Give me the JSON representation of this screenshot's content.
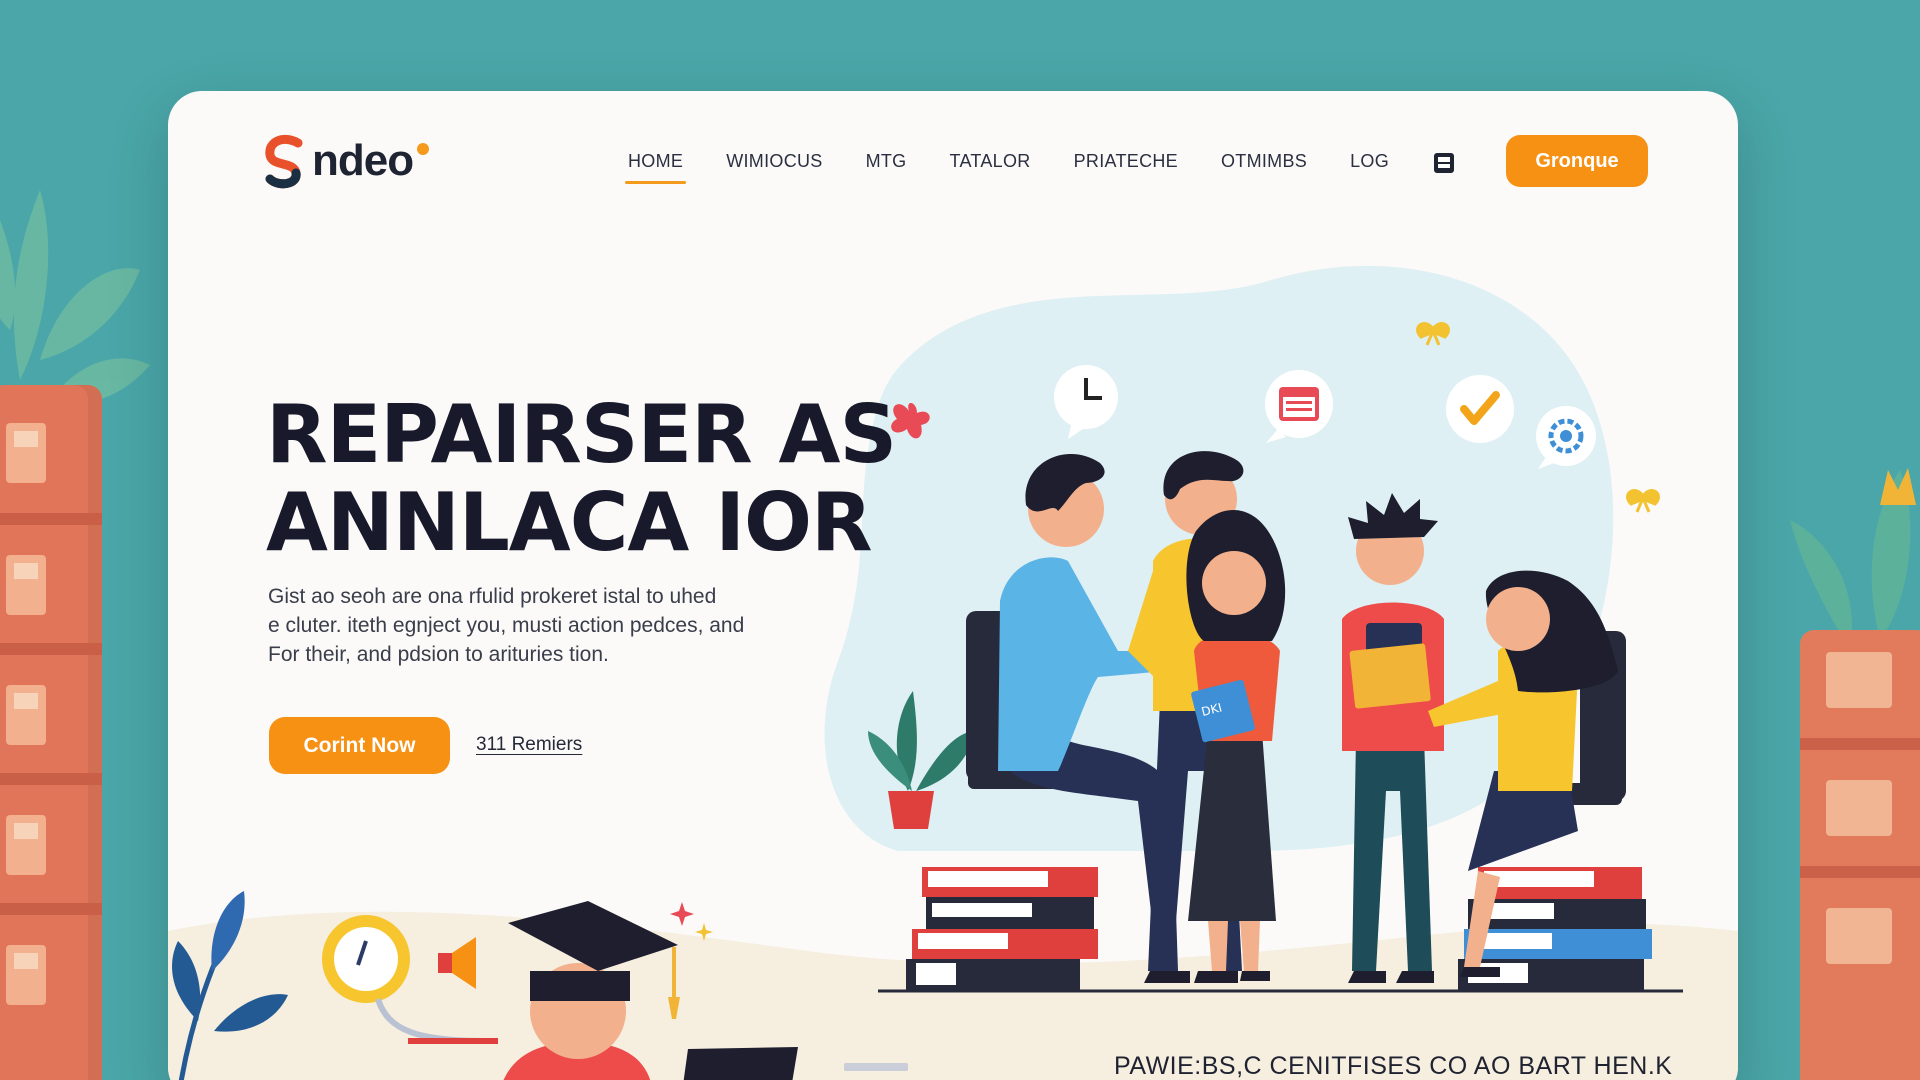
{
  "brand": {
    "name": "ndeo"
  },
  "nav": {
    "items": [
      {
        "label": "HOME",
        "active": true
      },
      {
        "label": "WIMIOCUS",
        "active": false
      },
      {
        "label": "MTG",
        "active": false
      },
      {
        "label": "TATALOR",
        "active": false
      },
      {
        "label": "PRIATECHE",
        "active": false
      },
      {
        "label": "OTMIMBS",
        "active": false
      },
      {
        "label": "LOG",
        "active": false
      }
    ],
    "icon": "bookmark-icon",
    "cta_label": "Gronque"
  },
  "hero": {
    "title_lines": [
      "REPAIRSER AS",
      "ANNLACA IOR"
    ],
    "description_lines": [
      "Gist ao seoh are ona rfulid prokeret istal to uhed",
      "e cluter. iteth egnject you, musti action pedces, and",
      "For their, and pdsion to arituries tion."
    ],
    "primary_button": "Corint Now",
    "secondary_link": "311 Remiers"
  },
  "bottom": {
    "caption": "PAWIE:BS,C CENITFISES CO AO BART HEN.K"
  },
  "illustration": {
    "book_label": "DKI"
  },
  "colors": {
    "accent": "#f69114",
    "background": "#4aa6a8",
    "card": "#fbfaf8",
    "heading": "#181a2c"
  }
}
